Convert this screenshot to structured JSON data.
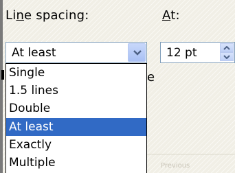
{
  "line_spacing_label": {
    "prefix": "Li",
    "accel": "n",
    "suffix": "e spacing:"
  },
  "at_label": {
    "accel": "A",
    "suffix": "t:"
  },
  "line_spacing": {
    "selected": "At least",
    "options": [
      "Single",
      "1.5 lines",
      "Double",
      "At least",
      "Exactly",
      "Multiple"
    ],
    "highlighted_index": 3
  },
  "at_value": "12 pt",
  "partial_text": "e",
  "faint_text": "Previous"
}
